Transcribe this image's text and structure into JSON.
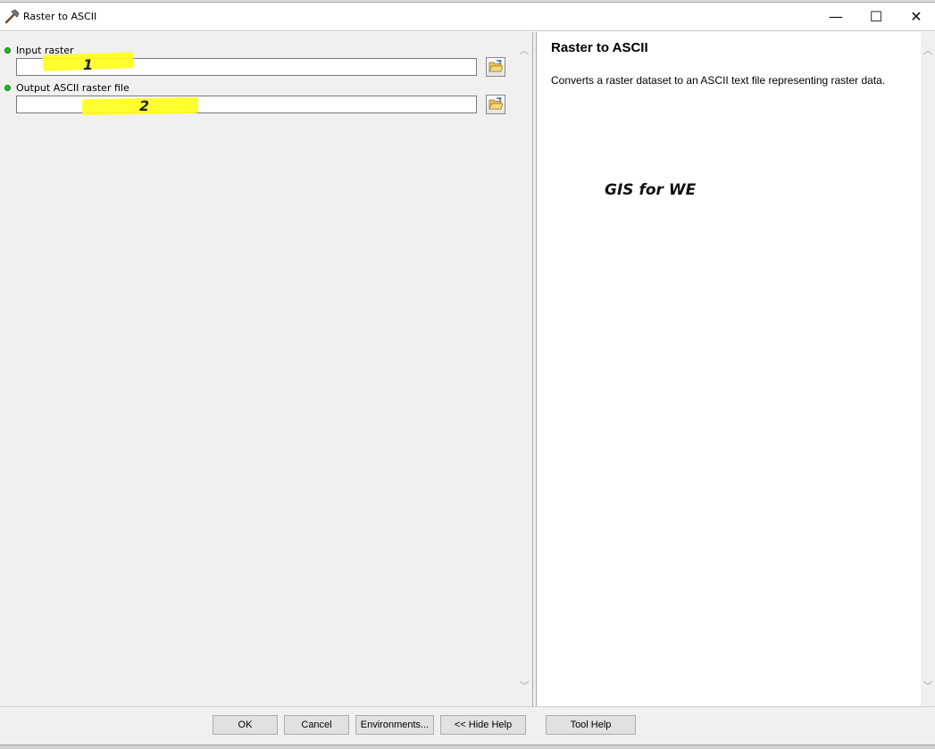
{
  "window": {
    "title": "Raster to ASCII",
    "icon": "hammer-tool-icon",
    "minimize_glyph": "—",
    "maximize_glyph": "☐",
    "close_glyph": "✕"
  },
  "parameters": [
    {
      "label": "Input raster",
      "value": "",
      "required": true,
      "annotation": "1"
    },
    {
      "label": "Output ASCII raster file",
      "value": "",
      "required": true,
      "annotation": "2"
    }
  ],
  "help": {
    "title": "Raster to ASCII",
    "description": "Converts a raster dataset to an ASCII text file representing raster data.",
    "watermark": "GIS for WE"
  },
  "buttons": {
    "ok": "OK",
    "cancel": "Cancel",
    "environments": "Environments...",
    "hide_help": "<< Hide Help",
    "tool_help": "Tool Help"
  },
  "colors": {
    "required_dot": "#1fc41f",
    "highlight": "#ffff1a"
  }
}
